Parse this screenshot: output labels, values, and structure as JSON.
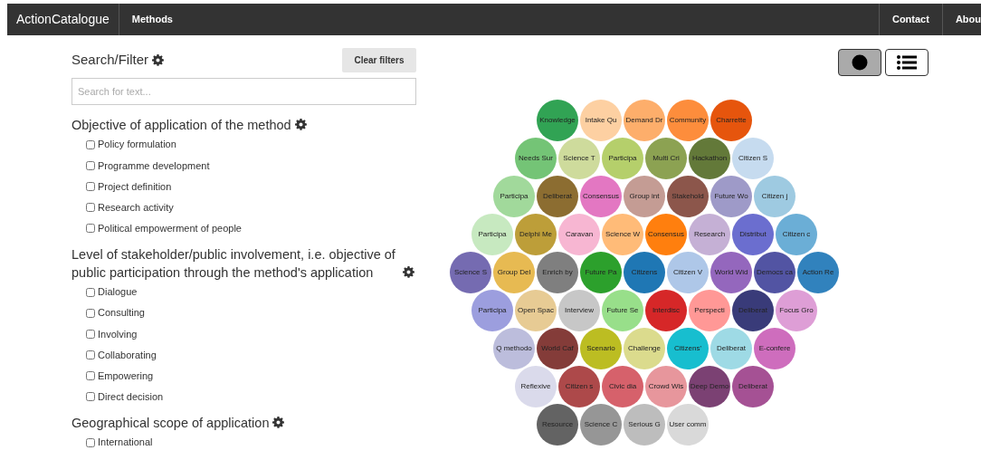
{
  "navbar": {
    "brand": "ActionCatalogue",
    "left_items": [
      "Methods"
    ],
    "right_items": [
      "Contact",
      "Abou"
    ]
  },
  "search": {
    "title": "Search/Filter",
    "clear_button": "Clear filters",
    "placeholder": "Search for text..."
  },
  "filter_groups": [
    {
      "title": "Objective of application of the method",
      "options": [
        {
          "label": "Policy formulation",
          "checked": false
        },
        {
          "label": "Programme development",
          "checked": false
        },
        {
          "label": "Project definition",
          "checked": false
        },
        {
          "label": "Research activity",
          "checked": false
        },
        {
          "label": "Political empowerment of people",
          "checked": false
        }
      ]
    },
    {
      "title": "Level of stakeholder/public involvement, i.e. objective of public participation through the method's application",
      "options": [
        {
          "label": "Dialogue",
          "checked": false
        },
        {
          "label": "Consulting",
          "checked": false
        },
        {
          "label": "Involving",
          "checked": false
        },
        {
          "label": "Collaborating",
          "checked": false
        },
        {
          "label": "Empowering",
          "checked": false
        },
        {
          "label": "Direct decision",
          "checked": false
        }
      ]
    },
    {
      "title": "Geographical scope of application",
      "options": [
        {
          "label": "International",
          "checked": false
        }
      ]
    }
  ],
  "view_toggle": [
    {
      "kind": "bubbles",
      "selected": true
    },
    {
      "kind": "list",
      "selected": false
    }
  ],
  "bubble_rows": [
    [
      {
        "label": "Knowledge",
        "color": "#31a354"
      },
      {
        "label": "Intake Qu",
        "color": "#fdd0a2"
      },
      {
        "label": "Demand Dr",
        "color": "#fdae6b"
      },
      {
        "label": "Community",
        "color": "#fd8d3c"
      },
      {
        "label": "Charrette",
        "color": "#e6550d"
      }
    ],
    [
      {
        "label": "Needs Sur",
        "color": "#74c476"
      },
      {
        "label": "Science T",
        "color": "#cedb9c"
      },
      {
        "label": "Participa",
        "color": "#b5cf6b"
      },
      {
        "label": "Multi Cri",
        "color": "#8ca252"
      },
      {
        "label": "Hackathon",
        "color": "#637939"
      },
      {
        "label": "Citizen S",
        "color": "#c6dbef"
      }
    ],
    [
      {
        "label": "Participa",
        "color": "#a1d99b"
      },
      {
        "label": "Deliberat",
        "color": "#8c6d31"
      },
      {
        "label": "Consensus",
        "color": "#e377c2"
      },
      {
        "label": "Group int",
        "color": "#c49c94"
      },
      {
        "label": "Stakehold",
        "color": "#8c564b"
      },
      {
        "label": "Future Wo",
        "color": "#9e9ac8"
      },
      {
        "label": "Citizen j",
        "color": "#9ecae1"
      }
    ],
    [
      {
        "label": "Participa",
        "color": "#c7e9c0"
      },
      {
        "label": "Delphi Me",
        "color": "#bd9e39"
      },
      {
        "label": "Caravan",
        "color": "#f7b6d2"
      },
      {
        "label": "Science W",
        "color": "#ffbb78"
      },
      {
        "label": "Consensus",
        "color": "#ff7f0e"
      },
      {
        "label": "Research",
        "color": "#c5b0d5"
      },
      {
        "label": "Distribut",
        "color": "#6b6ecf"
      },
      {
        "label": "Citizen c",
        "color": "#6baed6"
      }
    ],
    [
      {
        "label": "Science S",
        "color": "#756bb1"
      },
      {
        "label": "Group Del",
        "color": "#e7ba52"
      },
      {
        "label": "Enrich by",
        "color": "#7f7f7f"
      },
      {
        "label": "Future Pa",
        "color": "#2ca02c"
      },
      {
        "label": "Citizens",
        "color": "#1f77b4"
      },
      {
        "label": "Citizen V",
        "color": "#aec7e8"
      },
      {
        "label": "World Wid",
        "color": "#9467bd"
      },
      {
        "label": "Democs ca",
        "color": "#5254a3"
      },
      {
        "label": "Action Re",
        "color": "#3182bd"
      }
    ],
    [
      {
        "label": "Participa",
        "color": "#9c9ede"
      },
      {
        "label": "Open Spac",
        "color": "#e7cb94"
      },
      {
        "label": "Interview",
        "color": "#c7c7c7"
      },
      {
        "label": "Future Se",
        "color": "#98df8a"
      },
      {
        "label": "Interdisc",
        "color": "#d62728"
      },
      {
        "label": "Perspecti",
        "color": "#ff9896"
      },
      {
        "label": "Deliberat",
        "color": "#393b79"
      },
      {
        "label": "Focus Gro",
        "color": "#de9ed6"
      }
    ],
    [
      {
        "label": "Q methodo",
        "color": "#bcbddc"
      },
      {
        "label": "World Caf",
        "color": "#843c39"
      },
      {
        "label": "Scenario",
        "color": "#bcbd22"
      },
      {
        "label": "Challenge",
        "color": "#dbdb8d"
      },
      {
        "label": "Citizens'",
        "color": "#17becf"
      },
      {
        "label": "Deliberat",
        "color": "#9edae5"
      },
      {
        "label": "E-confere",
        "color": "#ce6dbd"
      }
    ],
    [
      {
        "label": "Reflexive",
        "color": "#dadaeb"
      },
      {
        "label": "Citizen s",
        "color": "#ad494a"
      },
      {
        "label": "Civic dia",
        "color": "#d6616b"
      },
      {
        "label": "Crowd Wis",
        "color": "#e7969c"
      },
      {
        "label": "Deep Demo",
        "color": "#7b4173"
      },
      {
        "label": "Deliberat",
        "color": "#a55194"
      }
    ],
    [
      {
        "label": "Resource",
        "color": "#636363"
      },
      {
        "label": "Science C",
        "color": "#969696"
      },
      {
        "label": "Serious G",
        "color": "#bdbdbd"
      },
      {
        "label": "User comm",
        "color": "#d9d9d9"
      }
    ]
  ]
}
